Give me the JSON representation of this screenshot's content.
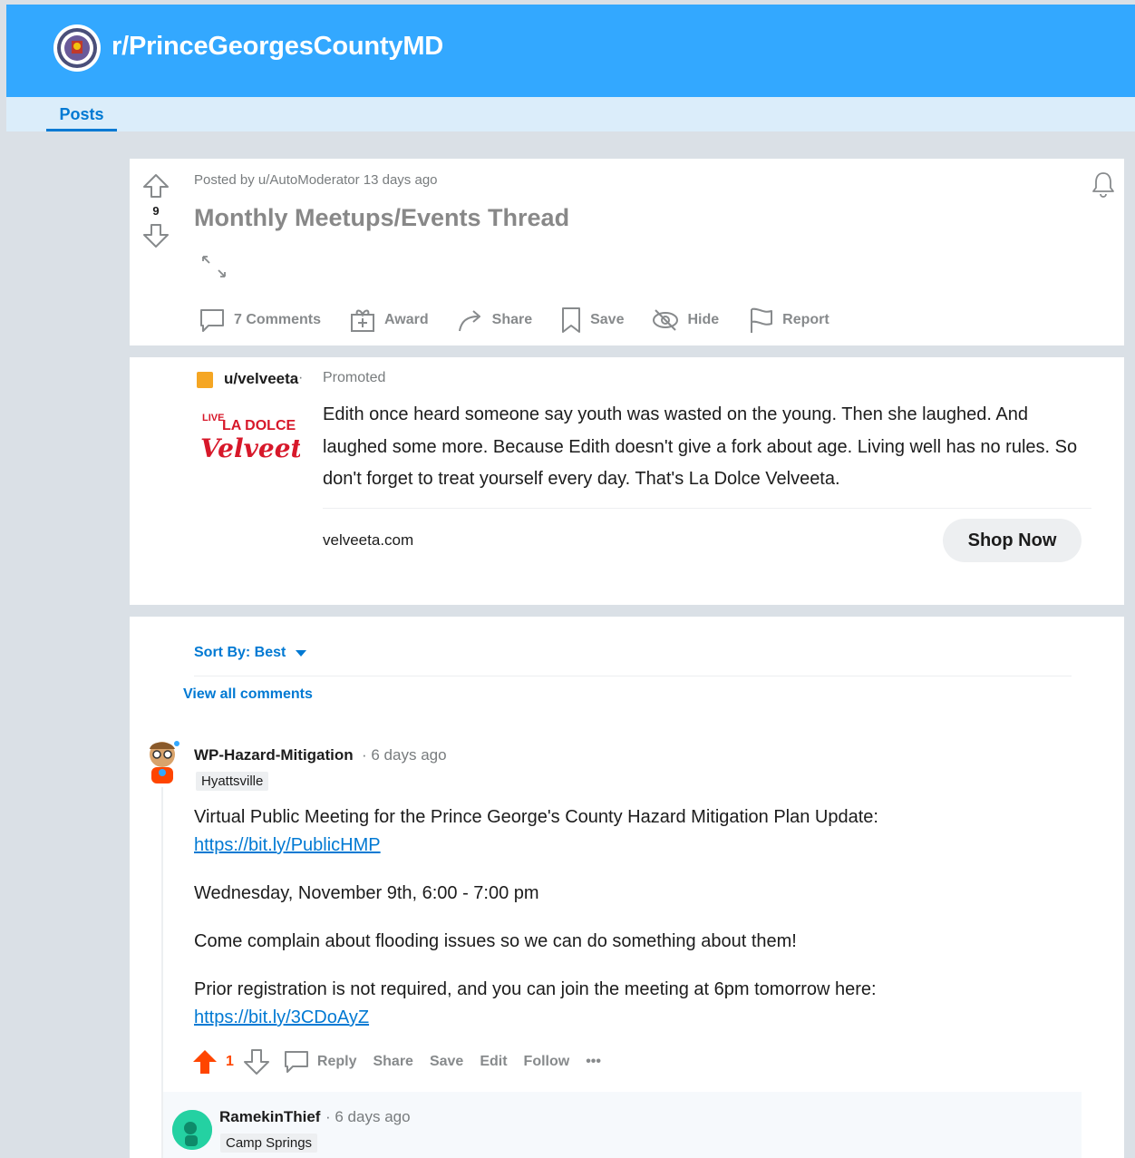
{
  "header": {
    "subreddit": "r/PrinceGeorgesCountyMD",
    "banner_color": "#33a8ff",
    "icon": "county-seal-icon"
  },
  "tabs": [
    {
      "label": "Posts",
      "active": true
    }
  ],
  "post": {
    "meta": "Posted by u/AutoModerator 13 days ago",
    "title": "Monthly Meetups/Events Thread",
    "score": "9",
    "actions": {
      "comments": "7 Comments",
      "award": "Award",
      "share": "Share",
      "save": "Save",
      "hide": "Hide",
      "report": "Report"
    }
  },
  "ad": {
    "user": "u/velveeta",
    "separator": "·",
    "promoted": "Promoted",
    "logo_text_1": "LIVE",
    "logo_text_2": "LA DOLCE",
    "logo_text_3": "Velveeta",
    "body": "Edith once heard someone say youth was wasted on the young. Then she laughed. And laughed some more. Because Edith doesn't give a fork about age. Living well has no rules. So don't forget to treat yourself every day. That's La Dolce Velveeta.",
    "domain": "velveeta.com",
    "cta": "Shop Now"
  },
  "comments_section": {
    "sort_label": "Sort By: Best",
    "view_all": "View all comments",
    "comments": [
      {
        "author": "WP-Hazard-Mitigation",
        "time": "· 6 days ago",
        "flair": "Hyattsville",
        "paragraph_1": "Virtual Public Meeting for the Prince George's County Hazard Mitigation Plan Update:",
        "link_1": "https://bit.ly/PublicHMP",
        "paragraph_2": "Wednesday, November 9th, 6:00 - 7:00 pm",
        "paragraph_3": "Come complain about flooding issues so we can do something about them!",
        "paragraph_4": "Prior registration is not required, and you can join the meeting at 6pm tomorrow here:",
        "link_2": "https://bit.ly/3CDoAyZ",
        "score": "1",
        "actions": {
          "reply": "Reply",
          "share": "Share",
          "save": "Save",
          "edit": "Edit",
          "follow": "Follow",
          "more": "•••"
        }
      },
      {
        "author": "RamekinThief",
        "time": "· 6 days ago",
        "flair": "Camp Springs"
      }
    ]
  },
  "colors": {
    "accent_blue": "#0079d3",
    "upvote_orange": "#ff4500",
    "muted_text": "#878a8c"
  }
}
